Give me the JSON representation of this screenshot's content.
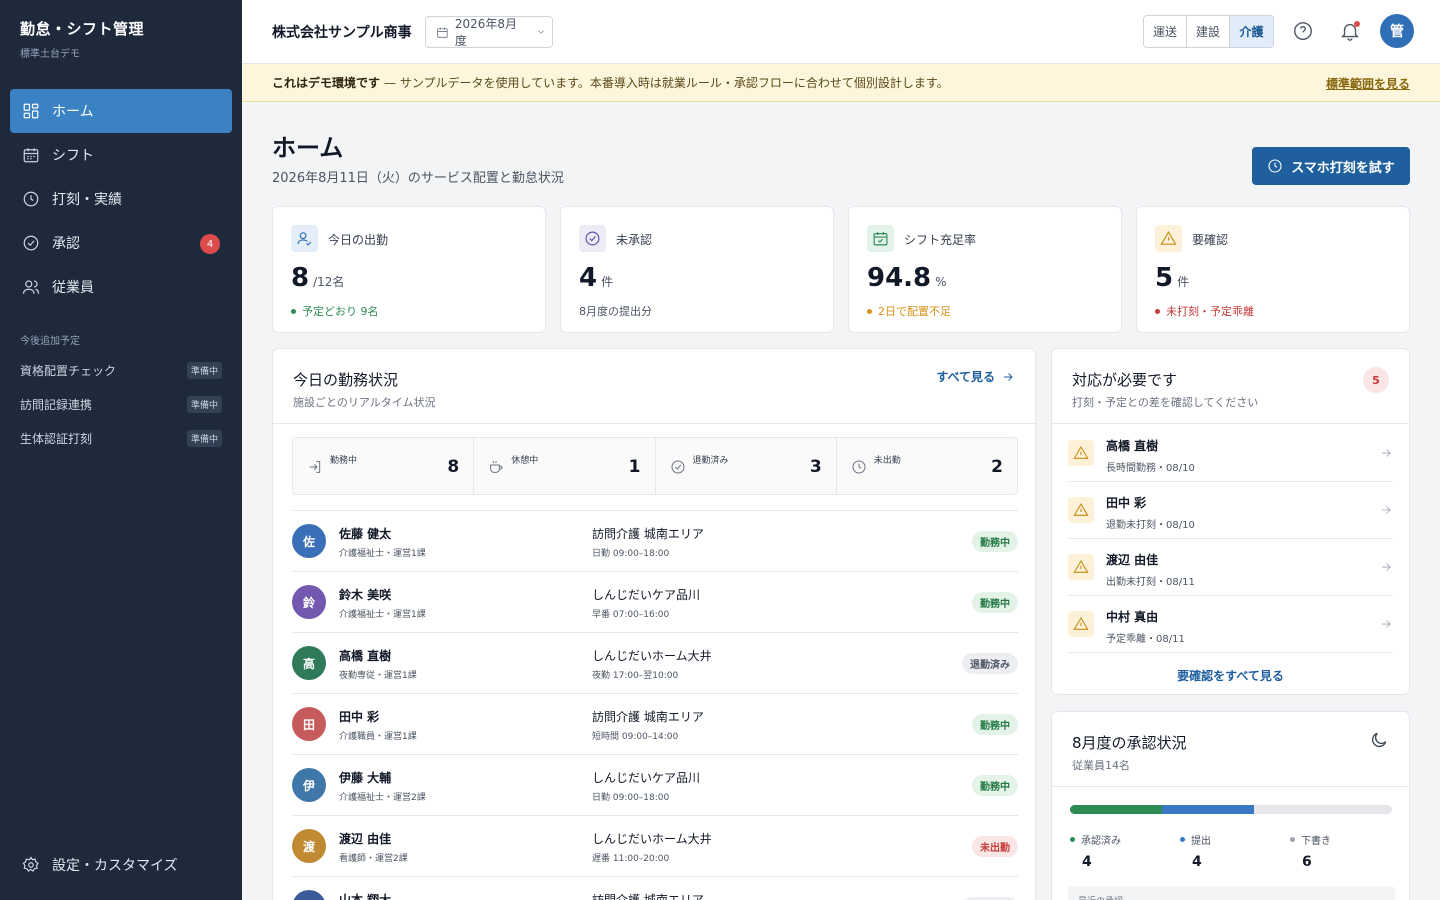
{
  "sidebar": {
    "title": "勤怠・シフト管理",
    "subtitle": "標準土台デモ",
    "nav": [
      {
        "label": "ホーム",
        "icon": "grid-icon",
        "active": true
      },
      {
        "label": "シフト",
        "icon": "calendar-icon"
      },
      {
        "label": "打刻・実績",
        "icon": "clock-icon"
      },
      {
        "label": "承認",
        "icon": "check-circle-icon",
        "badge": "4"
      },
      {
        "label": "従業員",
        "icon": "users-icon"
      }
    ],
    "future_heading": "今後追加予定",
    "future": [
      {
        "label": "資格配置チェック",
        "tag": "準備中"
      },
      {
        "label": "訪問記録連携",
        "tag": "準備中"
      },
      {
        "label": "生体認証打刻",
        "tag": "準備中"
      }
    ],
    "settings": "設定・カスタマイズ"
  },
  "topbar": {
    "company": "株式会社サンプル商事",
    "period": "2026年8月度",
    "industries": [
      "運送",
      "建設",
      "介護"
    ],
    "selected_industry": "介護",
    "avatar": "管"
  },
  "banner": {
    "strong": "これはデモ環境です",
    "text": "— サンプルデータを使用しています。本番導入時は就業ルール・承認フローに合わせて個別設計します。",
    "link": "標準範囲を見る"
  },
  "page": {
    "title": "ホーム",
    "subtitle": "2026年8月11日（火）のサービス配置と勤怠状況",
    "cta": "スマホ打刻を試す"
  },
  "kpis": [
    {
      "label": "今日の出勤",
      "value": "8",
      "unit": "/12名",
      "note": "予定どおり 9名",
      "note_color": "#2e8a55",
      "icon": "user-check-icon",
      "icon_bg": "#e4eef9",
      "icon_color": "#2f6fb5"
    },
    {
      "label": "未承認",
      "value": "4",
      "unit": "件",
      "note": "8月度の提出分",
      "note_color": "",
      "icon": "check-circle-icon",
      "icon_bg": "#ecebf6",
      "icon_color": "#5b4fa8"
    },
    {
      "label": "シフト充足率",
      "value": "94.8",
      "unit": "%",
      "note": "2日で配置不足",
      "note_color": "#d9921a",
      "icon": "calendar-check-icon",
      "icon_bg": "#e4f3ea",
      "icon_color": "#2e8a55"
    },
    {
      "label": "要確認",
      "value": "5",
      "unit": "件",
      "note": "未打刻・予定乖離",
      "note_color": "#c53a3a",
      "icon": "warning-icon",
      "icon_bg": "#fdf2d8",
      "icon_color": "#c58a10"
    }
  ],
  "today": {
    "title": "今日の勤務状況",
    "subtitle": "施設ごとのリアルタイム状況",
    "see_all": "すべて見る",
    "stats": [
      {
        "label": "勤務中",
        "value": "8",
        "icon": "login-icon"
      },
      {
        "label": "休憩中",
        "value": "1",
        "icon": "coffee-icon"
      },
      {
        "label": "退勤済み",
        "value": "3",
        "icon": "check-circle-icon"
      },
      {
        "label": "未出勤",
        "value": "2",
        "icon": "clock-icon"
      }
    ],
    "rows": [
      {
        "initial": "佐",
        "color": "#3b6fb8",
        "name": "佐藤 健太",
        "role": "介護福祉士・運営1課",
        "facility": "訪問介護 城南エリア",
        "time": "日勤 09:00–18:00",
        "status": "勤務中",
        "kind": "work"
      },
      {
        "initial": "鈴",
        "color": "#7458b0",
        "name": "鈴木 美咲",
        "role": "介護福祉士・運営1課",
        "facility": "しんじだいケア品川",
        "time": "早番 07:00–16:00",
        "status": "勤務中",
        "kind": "work"
      },
      {
        "initial": "高",
        "color": "#2f7a59",
        "name": "高橋 直樹",
        "role": "夜勤専従・運営1課",
        "facility": "しんじだいホーム大井",
        "time": "夜勤 17:00–翌10:00",
        "status": "退勤済み",
        "kind": "left"
      },
      {
        "initial": "田",
        "color": "#c75a5a",
        "name": "田中 彩",
        "role": "介護職員・運営1課",
        "facility": "訪問介護 城南エリア",
        "time": "短時間 09:00–14:00",
        "status": "勤務中",
        "kind": "work"
      },
      {
        "initial": "伊",
        "color": "#3f77a8",
        "name": "伊藤 大輔",
        "role": "介護福祉士・運営2課",
        "facility": "しんじだいケア品川",
        "time": "日勤 09:00–18:00",
        "status": "勤務中",
        "kind": "work"
      },
      {
        "initial": "渡",
        "color": "#c08a32",
        "name": "渡辺 由佳",
        "role": "看護師・運営2課",
        "facility": "しんじだいホーム大井",
        "time": "遅番 11:00–20:00",
        "status": "未出勤",
        "kind": "absent"
      },
      {
        "initial": "山",
        "color": "#3b5a9a",
        "name": "山本 翔大",
        "role": "",
        "facility": "訪問介護 城南エリア",
        "time": "",
        "status": "",
        "kind": "left"
      }
    ]
  },
  "alerts": {
    "title": "対応が必要です",
    "subtitle": "打刻・予定との差を確認してください",
    "count": "5",
    "items": [
      {
        "name": "高橋 直樹",
        "detail": "長時間勤務・08/10"
      },
      {
        "name": "田中 彩",
        "detail": "退勤未打刻・08/10"
      },
      {
        "name": "渡辺 由佳",
        "detail": "出勤未打刻・08/11"
      },
      {
        "name": "中村 真由",
        "detail": "予定乖離・08/11"
      }
    ],
    "link": "要確認をすべて見る"
  },
  "approval": {
    "title": "8月度の承認状況",
    "subtitle": "従業員14名",
    "segments": [
      {
        "label": "承認済み",
        "value": 4,
        "color": "#2e8a55"
      },
      {
        "label": "提出",
        "value": 4,
        "color": "#3b78c4"
      },
      {
        "label": "下書き",
        "value": 6,
        "color": "#9ca3af"
      }
    ],
    "recent": "最近の承認"
  }
}
